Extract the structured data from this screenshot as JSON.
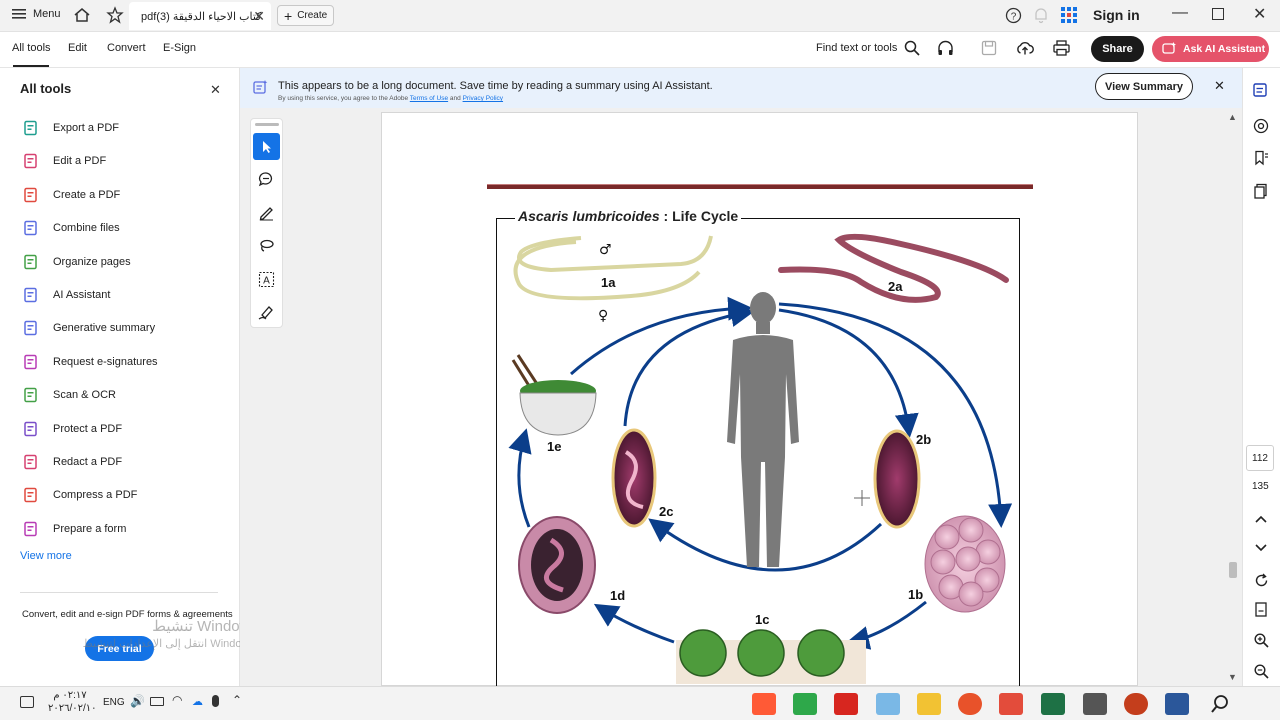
{
  "tabbar": {
    "menu_label": "Menu",
    "tab_title": "كتاب الاحياء الدقيقة (3)pdf",
    "create_label": "Create",
    "sign_in": "Sign in"
  },
  "menubar": {
    "items": [
      "All tools",
      "Edit",
      "Convert",
      "E-Sign"
    ],
    "find_label": "Find text or tools",
    "share_label": "Share",
    "ask_ai_label": "Ask AI Assistant"
  },
  "sidebar": {
    "title": "All tools",
    "tools": [
      {
        "label": "Export a PDF",
        "color": "#1f9e8f",
        "icon": "export-pdf-icon"
      },
      {
        "label": "Edit a PDF",
        "color": "#d64070",
        "icon": "edit-pdf-icon"
      },
      {
        "label": "Create a PDF",
        "color": "#e04a3f",
        "icon": "create-pdf-icon"
      },
      {
        "label": "Combine files",
        "color": "#5b6ee1",
        "icon": "combine-files-icon"
      },
      {
        "label": "Organize pages",
        "color": "#43a047",
        "icon": "organize-pages-icon"
      },
      {
        "label": "AI Assistant",
        "color": "#5b6ee1",
        "icon": "ai-assistant-icon"
      },
      {
        "label": "Generative summary",
        "color": "#5b6ee1",
        "icon": "generative-summary-icon"
      },
      {
        "label": "Request e-signatures",
        "color": "#b83cb5",
        "icon": "e-signature-icon"
      },
      {
        "label": "Scan & OCR",
        "color": "#43a047",
        "icon": "scan-ocr-icon"
      },
      {
        "label": "Protect a PDF",
        "color": "#7a4fc9",
        "icon": "protect-pdf-icon"
      },
      {
        "label": "Redact a PDF",
        "color": "#d64070",
        "icon": "redact-pdf-icon"
      },
      {
        "label": "Compress a PDF",
        "color": "#e04a3f",
        "icon": "compress-pdf-icon"
      },
      {
        "label": "Prepare a form",
        "color": "#b83cb5",
        "icon": "prepare-form-icon"
      }
    ],
    "view_more": "View more",
    "promo_text": "Convert, edit and e-sign PDF forms & agreements",
    "free_trial": "Free trial"
  },
  "banner": {
    "message": "This appears to be a long document. Save time by reading a summary using AI Assistant.",
    "fine_print_prefix": "By using this service, you agree to the Adobe",
    "terms_link": "Terms of Use",
    "and": "and",
    "privacy_link": "Privacy Policy",
    "view_summary": "View Summary"
  },
  "document": {
    "figure_title_italic": "Ascaris lumbricoides",
    "figure_title_rest": ": Life Cycle",
    "labels": [
      "1a",
      "2a",
      "2b",
      "2c",
      "1b",
      "1c",
      "1d",
      "1e"
    ],
    "male_symbol": "♂",
    "female_symbol": "♀"
  },
  "rightrail": {
    "page_current": "112",
    "page_total": "135"
  },
  "watermark": {
    "line1": "تنشيط Windows",
    "line2": "انتقل إلى الإعدادات لتنشيط Windows."
  },
  "taskbar": {
    "time": "٠٢:١٧ م",
    "date": "٢٠٢٦/٠٢/١٠",
    "lang": "ENG"
  },
  "colors": {
    "accent": "#1473e6",
    "share_bg": "#1a1a1a",
    "ai_bg": "#e5536a",
    "cycle_arrow": "#0b3e8a",
    "title_rule": "#7a2a2a"
  }
}
